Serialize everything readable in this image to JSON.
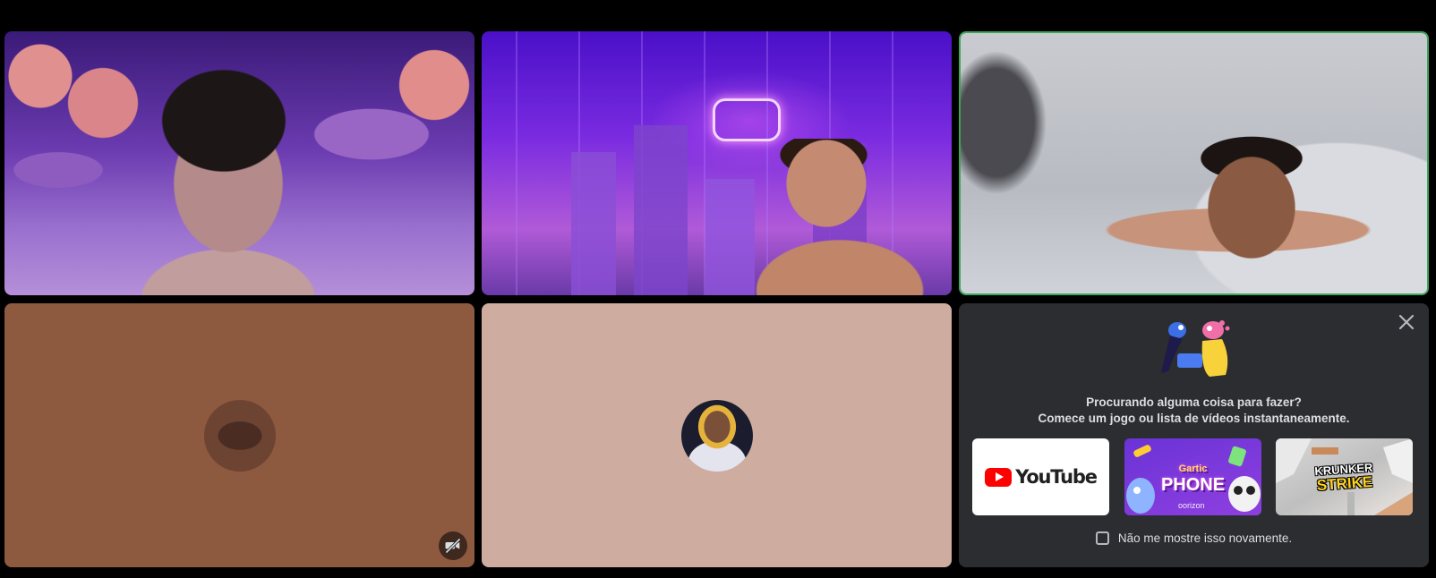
{
  "participants": [
    {
      "id": "p1",
      "video": "on"
    },
    {
      "id": "p2",
      "video": "on"
    },
    {
      "id": "p3",
      "video": "on",
      "speaking": true
    },
    {
      "id": "p4",
      "video": "off",
      "tile_color": "#8d5a40",
      "status_icon": "camera-off-icon"
    },
    {
      "id": "p5",
      "video": "off",
      "tile_color": "#cfaca0"
    }
  ],
  "activity_panel": {
    "close_icon": "close-icon",
    "prompt_line1": "Procurando alguma coisa para fazer?",
    "prompt_line2": "Comece um jogo ou lista de vídeos instantaneamente.",
    "activities": [
      {
        "name": "YouTube",
        "logo_text": "YouTube"
      },
      {
        "name": "Gartic Phone",
        "logo_text_top": "Gartic",
        "logo_text_main": "PHONE",
        "brand": "oorizon"
      },
      {
        "name": "Krunker Strike",
        "logo_text_top": "KRUNKER",
        "logo_text_main": "STRIKE"
      }
    ],
    "dont_show_label": "Não me mostre isso novamente."
  },
  "colors": {
    "speaking_border": "#3ba55c",
    "panel_bg": "#2b2d31",
    "youtube_red": "#ff0000"
  }
}
